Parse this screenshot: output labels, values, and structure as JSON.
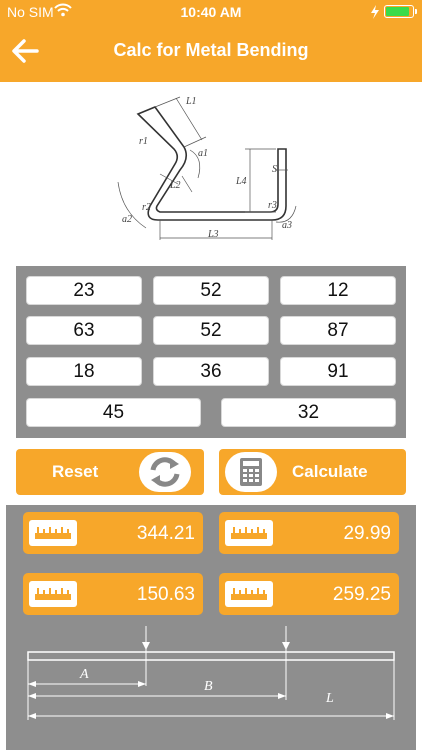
{
  "status": {
    "carrier": "No SIM",
    "time": "10:40 AM"
  },
  "header": {
    "title": "Calc for Metal Bending"
  },
  "diagram": {
    "labels": {
      "L1": "L1",
      "L2": "L2",
      "L3": "L3",
      "L4": "L4",
      "S": "S",
      "r1": "r1",
      "r2": "r2",
      "r3": "r3",
      "a1": "a1",
      "a2": "a2",
      "a3": "a3"
    }
  },
  "inputs": {
    "row1": [
      "23",
      "52",
      "12"
    ],
    "row2": [
      "63",
      "52",
      "87"
    ],
    "row3": [
      "18",
      "36",
      "91"
    ],
    "row4": [
      "45",
      "32"
    ]
  },
  "actions": {
    "reset_label": "Reset",
    "calculate_label": "Calculate"
  },
  "results": {
    "r1": "344.21",
    "r2": "29.99",
    "r3": "150.63",
    "r4": "259.25"
  },
  "drawing": {
    "label_a": "A",
    "label_b": "B",
    "label_l": "L"
  },
  "colors": {
    "accent": "#f7a72a",
    "panel": "#8e8e8e"
  }
}
